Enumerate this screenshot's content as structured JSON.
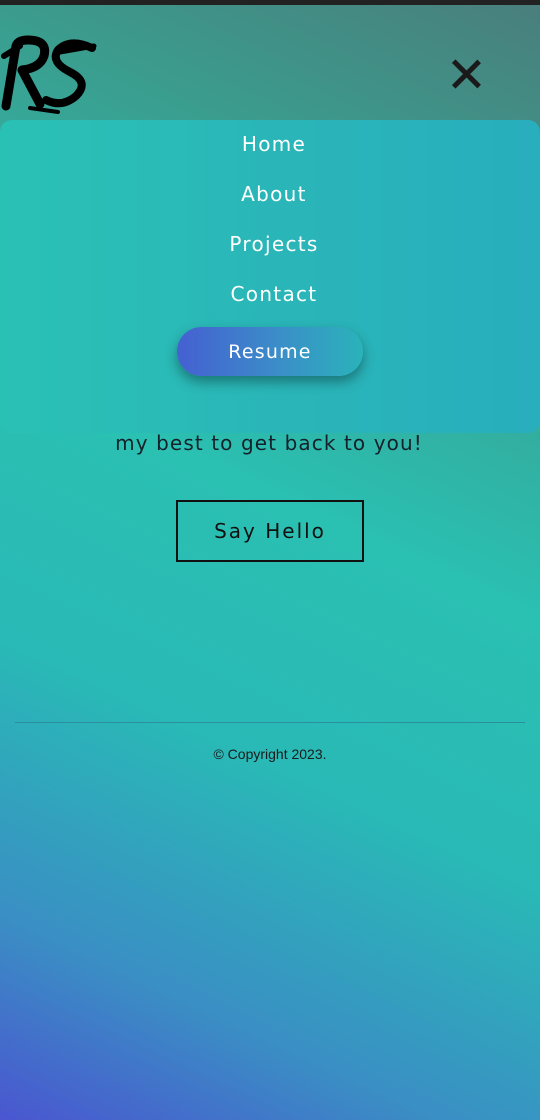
{
  "header": {
    "logo_text": "RS",
    "close_icon": "close-icon"
  },
  "menu": {
    "items": [
      {
        "label": "Home"
      },
      {
        "label": "About"
      },
      {
        "label": "Projects"
      },
      {
        "label": "Contact"
      }
    ],
    "resume_label": "Resume"
  },
  "contact": {
    "text": "my best to get back to you!",
    "say_hello_label": "Say Hello"
  },
  "footer": {
    "copyright": "© Copyright 2023."
  },
  "colors": {
    "menu_bg": "#2ab6b8",
    "resume_gradient_start": "#4560d2",
    "resume_gradient_end": "#2ab3ba",
    "text_dark": "#14212a"
  }
}
